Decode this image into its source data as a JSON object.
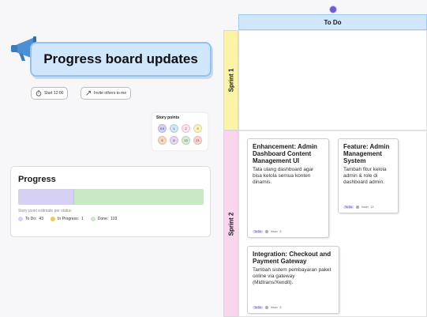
{
  "header": {
    "title": "Progress board updates",
    "start_button": "Start 12:00",
    "invite_button": "Invite others to me"
  },
  "story_points": {
    "title": "Story points",
    "values": [
      "0.5",
      "1",
      "2",
      "3",
      "5",
      "8",
      "13",
      "21"
    ],
    "colors": [
      "#d7d0f5",
      "#cfe6fb",
      "#fbe3f0",
      "#fbf3b8",
      "#fbd9c0",
      "#e8d6f7",
      "#d7ecd9",
      "#fbd4d4"
    ]
  },
  "progress": {
    "title": "Progress",
    "subtitle": "Story point estimate per status",
    "todo_fraction": 0.297,
    "in_progress_fraction": 0.007,
    "done_fraction": 0.696,
    "legend": [
      {
        "label": "To Do:",
        "value": "43",
        "color": "#d7d0f5"
      },
      {
        "label": "In Progress:",
        "value": "1",
        "color": "#f2c94c"
      },
      {
        "label": "Done:",
        "value": "103",
        "color": "#c7eac3"
      }
    ]
  },
  "board": {
    "column": "To Do",
    "lanes": [
      {
        "label": "Sprint 1",
        "color": "#fbf3a6"
      },
      {
        "label": "Sprint 2",
        "color": "#f9d6ee"
      }
    ],
    "cards": [
      {
        "title": "Enhancement: Admin Dashboard Content Management UI",
        "desc": "Tata ulang dashboard agar bisa kelola semua konten dinamis.",
        "tag": "To Do",
        "user": "ihsan",
        "points": "8"
      },
      {
        "title": "Feature: Admin Management System",
        "desc": "Tambah fitur kelola admin & role di dashboard admin.",
        "tag": "To Do",
        "user": "ihsan",
        "points": "13"
      },
      {
        "title": "Integration: Checkout and Payment Gateway",
        "desc": "Tambah sistem pembayaran paket online via gateway (Midtrans/Xendit).",
        "tag": "To Do",
        "user": "ihsan",
        "points": "8"
      }
    ]
  }
}
